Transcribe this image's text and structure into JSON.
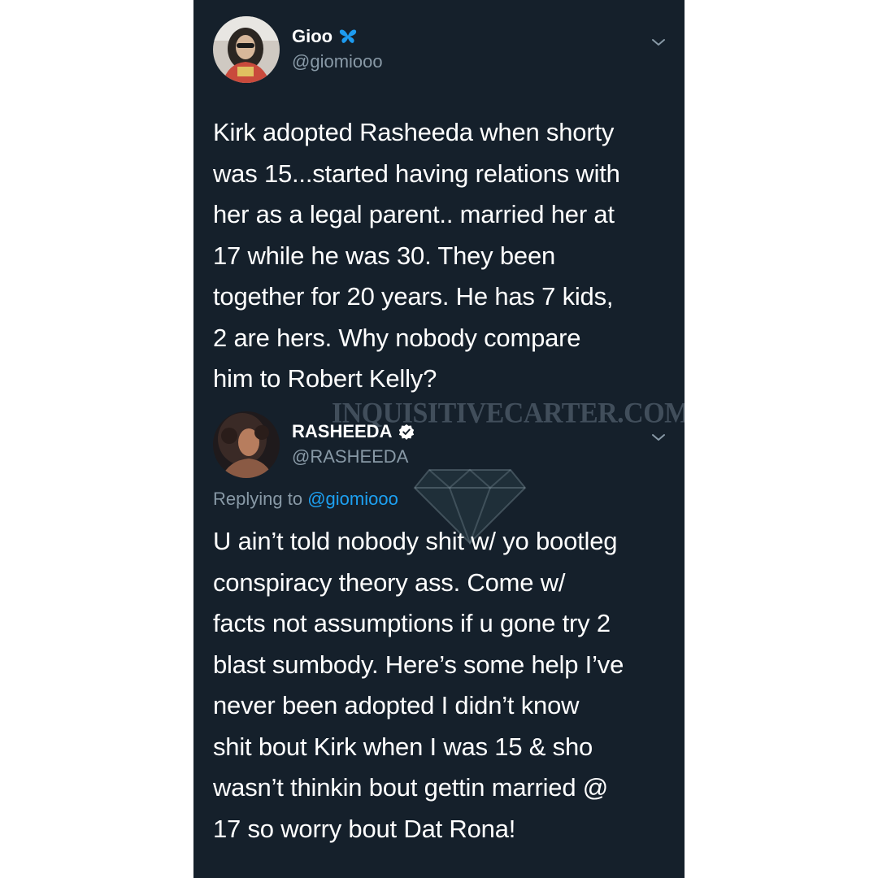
{
  "tweets": [
    {
      "display_name": "Gioo",
      "handle": "@giomiooo",
      "text": "Kirk adopted Rasheeda when shorty\nwas 15...started having relations with\nher as a legal parent.. married her at\n17 while he was 30. They been\ntogether for 20 years. He has 7 kids,\n2 are hers. Why nobody compare\nhim to Robert Kelly?"
    },
    {
      "display_name": "RASHEEDA",
      "handle": "@RASHEEDA",
      "reply_prefix": "Replying to ",
      "reply_mention": "@giomiooo",
      "text": "U ain’t told nobody shit w/ yo bootleg\nconspiracy theory ass. Come w/\nfacts not assumptions if u gone try 2\nblast sumbody. Here’s some help I’ve\nnever been adopted I didn’t know\nshit bout Kirk when I was 15 & sho\nwasn’t thinkin bout gettin married @\n17 so worry bout Dat Rona!"
    }
  ],
  "watermark": "INQUISITIVECARTER.COM",
  "icons": {
    "gioo_badge": "butterfly-icon",
    "rasheeda_badge": "verified-badge-icon",
    "caret": "chevron-down-icon",
    "watermark_logo": "diamond-icon"
  },
  "colors": {
    "background": "#15202b",
    "primary_text": "#ffffff",
    "secondary_text": "#8899a6",
    "link": "#1da1f2",
    "butterfly": "#1d9bf0"
  }
}
